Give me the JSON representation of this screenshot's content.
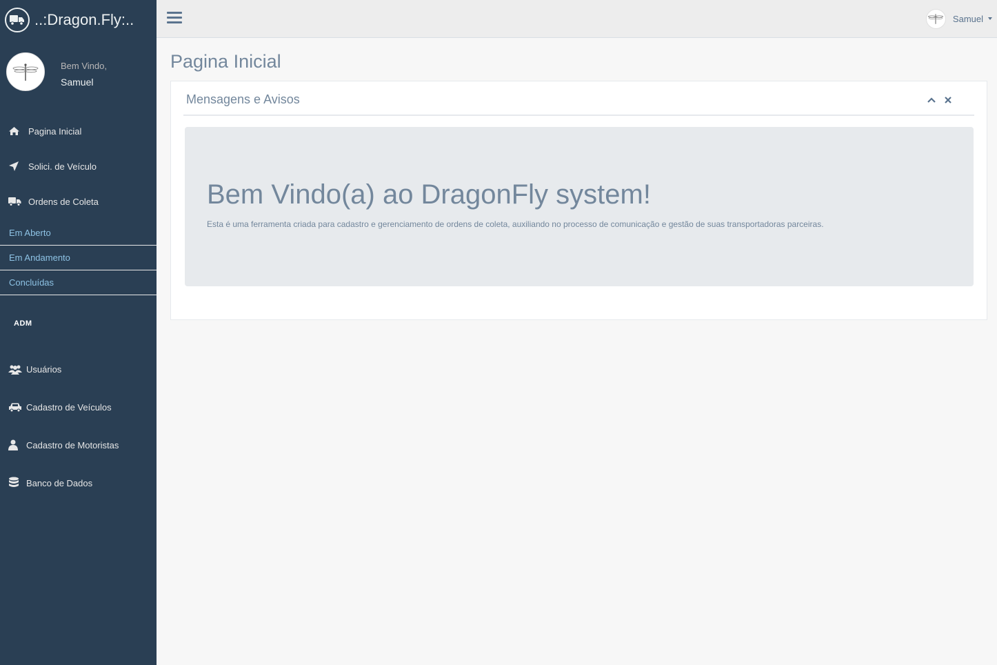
{
  "brand": {
    "title": "..:Dragon.Fly:.."
  },
  "profile": {
    "welcome": "Bem Vindo,",
    "name": "Samuel"
  },
  "nav": {
    "main": [
      {
        "label": "Pagina Inicial",
        "icon": "home-icon"
      },
      {
        "label": "Solici. de Veículo",
        "icon": "paper-plane-icon"
      },
      {
        "label": "Ordens de Coleta",
        "icon": "truck-icon"
      }
    ],
    "sub": [
      {
        "label": "Em Aberto"
      },
      {
        "label": "Em Andamento"
      },
      {
        "label": "Concluídas"
      }
    ],
    "section_label": "ADM",
    "admin": [
      {
        "label": "Usuários",
        "icon": "users-icon"
      },
      {
        "label": "Cadastro de Veículos",
        "icon": "car-icon"
      },
      {
        "label": "Cadastro de Motoristas",
        "icon": "user-icon"
      },
      {
        "label": "Banco de Dados",
        "icon": "database-icon"
      }
    ]
  },
  "topbar": {
    "user_name": "Samuel"
  },
  "page": {
    "title": "Pagina Inicial",
    "panel_title": "Mensagens e Avisos",
    "jumbotron_title": "Bem Vindo(a) ao DragonFly system!",
    "jumbotron_text": "Esta é uma ferramenta criada para cadastro e gerenciamento de ordens de coleta, auxiliando no processo de comunicação e gestão de suas transportadoras parceiras."
  },
  "colors": {
    "sidebar_bg": "#2a3f54",
    "content_bg": "#f7f7f7",
    "accent_text": "#73879c",
    "submenu_link": "#8ec3e5"
  }
}
